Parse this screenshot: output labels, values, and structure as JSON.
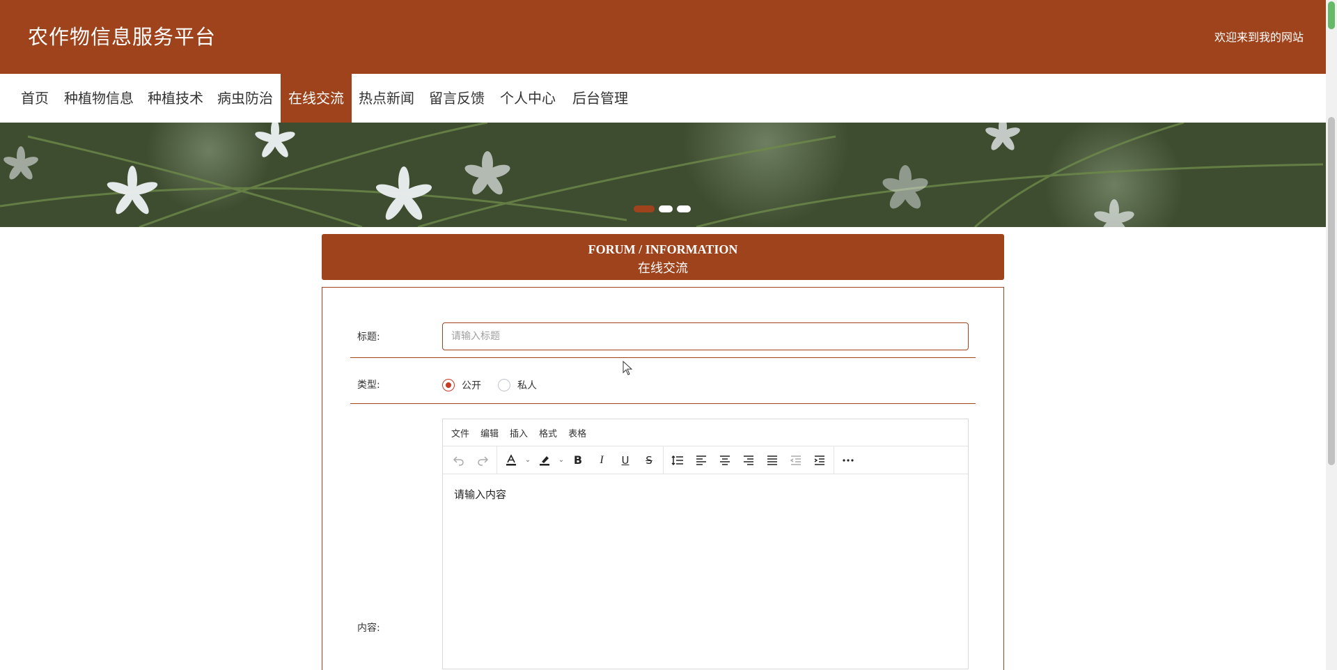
{
  "header": {
    "site_title": "农作物信息服务平台",
    "welcome": "欢迎来到我的网站"
  },
  "nav": {
    "items": [
      {
        "label": "首页",
        "active": false
      },
      {
        "label": "种植物信息",
        "active": false
      },
      {
        "label": "种植技术",
        "active": false
      },
      {
        "label": "病虫防治",
        "active": false
      },
      {
        "label": "在线交流",
        "active": true
      },
      {
        "label": "热点新闻",
        "active": false
      },
      {
        "label": "留言反馈",
        "active": false
      },
      {
        "label": "个人中心",
        "active": false
      },
      {
        "label": "后台管理",
        "active": false
      }
    ]
  },
  "banner": {
    "slide_count": 3,
    "active_slide": 1
  },
  "section": {
    "title_en": "FORUM / INFORMATION",
    "title_cn": "在线交流"
  },
  "form": {
    "title_label": "标题:",
    "title_placeholder": "请输入标题",
    "title_value": "",
    "type_label": "类型:",
    "type_options": [
      "公开",
      "私人"
    ],
    "type_selected": "公开",
    "content_label": "内容:"
  },
  "editor": {
    "menus": [
      "文件",
      "编辑",
      "插入",
      "格式",
      "表格"
    ],
    "placeholder": "请输入内容",
    "toolbar_icons": [
      "undo-icon",
      "redo-icon",
      "text-color-icon",
      "highlight-icon",
      "bold-icon",
      "italic-icon",
      "underline-icon",
      "strikethrough-icon",
      "line-height-icon",
      "align-left-icon",
      "align-center-icon",
      "align-right-icon",
      "align-justify-icon",
      "outdent-icon",
      "indent-icon",
      "more-icon"
    ]
  },
  "colors": {
    "primary": "#9e431c",
    "radio_checked": "#c23b22"
  }
}
